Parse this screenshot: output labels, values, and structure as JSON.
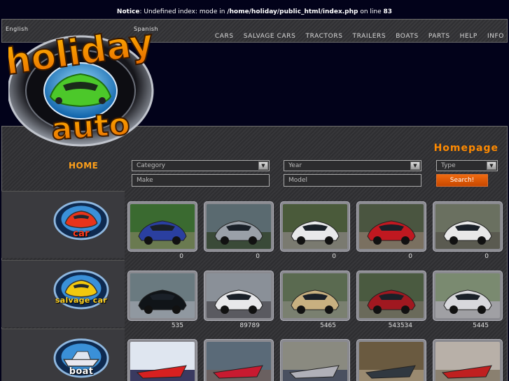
{
  "notice": {
    "label": "Notice",
    "message": ": Undefined index: mode in ",
    "path": "/home/holiday/public_html/index.php",
    "line_prefix": " on line ",
    "line": "83"
  },
  "languages": {
    "english": "English",
    "spanish": "Spanish"
  },
  "nav": [
    "CARS",
    "SALVAGE CARS",
    "TRACTORS",
    "TRAILERS",
    "BOATS",
    "PARTS",
    "HELP",
    "INFO"
  ],
  "logo": {
    "top": "holiday",
    "bottom": "auto"
  },
  "page_title": "Homepage",
  "home_label": "HOME",
  "search": {
    "category": "Category",
    "year": "Year",
    "type": "Type",
    "make_placeholder": "Make",
    "model_placeholder": "Model",
    "button": "Search!"
  },
  "categories": [
    {
      "label": "car",
      "color": "#e8341a",
      "counts": [
        "0",
        "0",
        "0",
        "0",
        "0"
      ]
    },
    {
      "label": "salvage car",
      "color": "#f2c80e",
      "counts": [
        "535",
        "89789",
        "5465",
        "543534",
        "5445"
      ]
    },
    {
      "label": "boat",
      "color": "#e8e8f0",
      "counts": []
    }
  ],
  "colors": {
    "accent": "#ff8a00",
    "background": "#02021a",
    "button": "#e05a08"
  }
}
